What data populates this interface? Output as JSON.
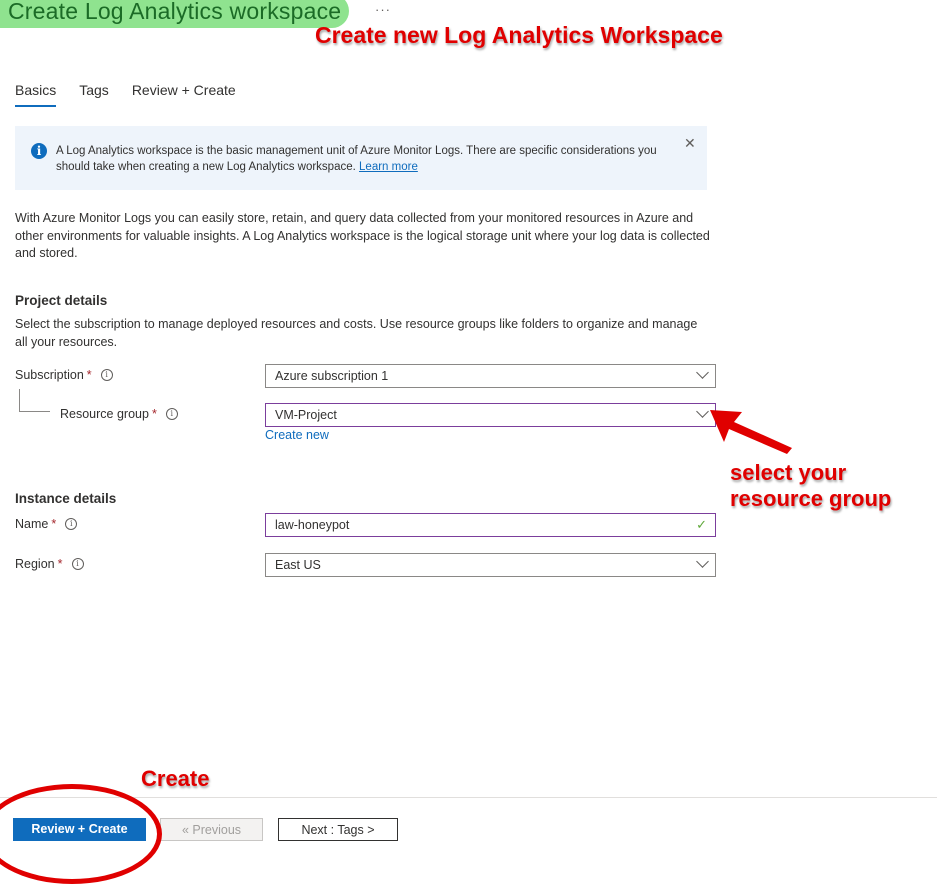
{
  "header": {
    "title": "Create Log Analytics workspace",
    "more_label": "···"
  },
  "annotations": {
    "title_note": "Create new Log Analytics Workspace",
    "rg_note_line1": "select your",
    "rg_note_line2": "resource group",
    "create_note": "Create",
    "color": "#e00000",
    "title_highlight": "#8fe38f"
  },
  "tabs": [
    {
      "label": "Basics",
      "active": true
    },
    {
      "label": "Tags",
      "active": false
    },
    {
      "label": "Review + Create",
      "active": false
    }
  ],
  "info_banner": {
    "icon": "info-icon",
    "text": "A Log Analytics workspace is the basic management unit of Azure Monitor Logs. There are specific considerations you should take when creating a new Log Analytics workspace.",
    "link": "Learn more",
    "close_icon": "close-icon"
  },
  "description": "With Azure Monitor Logs you can easily store, retain, and query data collected from your monitored resources in Azure and other environments for valuable insights. A Log Analytics workspace is the logical storage unit where your log data is collected and stored.",
  "project_details": {
    "heading": "Project details",
    "description": "Select the subscription to manage deployed resources and costs. Use resource groups like folders to organize and manage all your resources.",
    "subscription": {
      "label": "Subscription",
      "required": "*",
      "value": "Azure subscription 1"
    },
    "resource_group": {
      "label": "Resource group",
      "required": "*",
      "value": "VM-Project",
      "create_new": "Create new"
    }
  },
  "instance_details": {
    "heading": "Instance details",
    "name": {
      "label": "Name",
      "required": "*",
      "value": "law-honeypot",
      "valid_icon": "check-icon"
    },
    "region": {
      "label": "Region",
      "required": "*",
      "value": "East US"
    }
  },
  "footer": {
    "review_create": "Review + Create",
    "previous": "« Previous",
    "next": "Next : Tags >"
  },
  "colors": {
    "accent": "#0f6cbd",
    "focus_border": "#7b3e9c",
    "required": "#a4262c",
    "valid": "#5fa83a"
  }
}
